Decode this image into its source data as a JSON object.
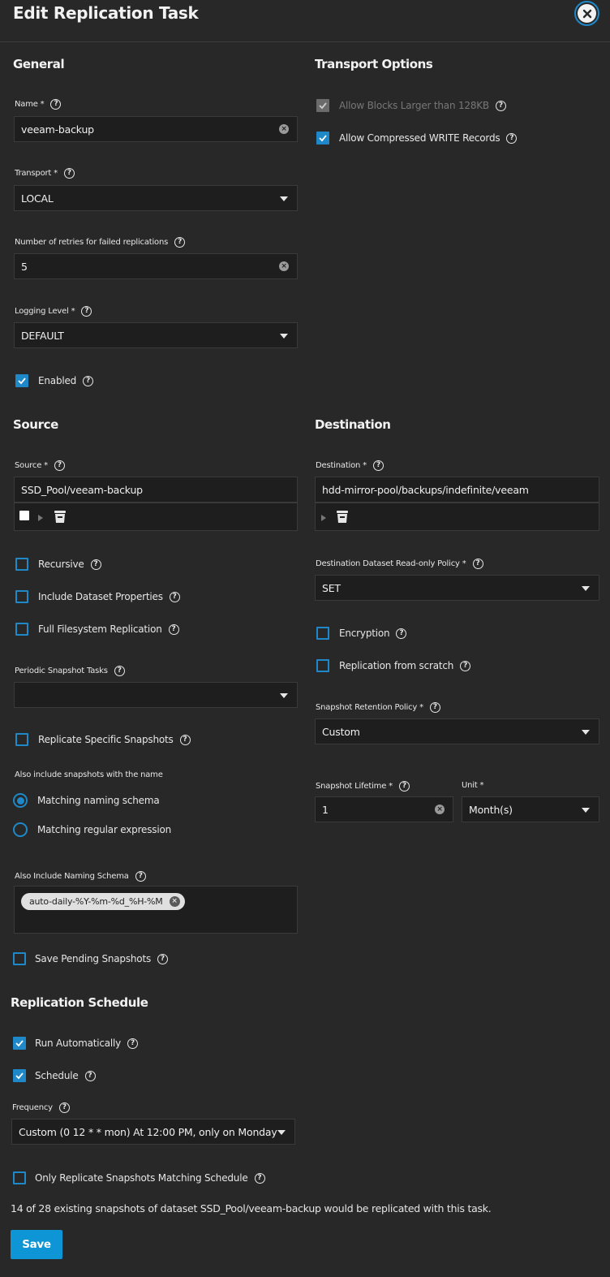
{
  "dialog": {
    "title": "Edit Replication Task",
    "close_icon": "close-icon"
  },
  "general": {
    "heading": "General",
    "name": {
      "label": "Name *",
      "value": "veeam-backup"
    },
    "transport": {
      "label": "Transport *",
      "value": "LOCAL"
    },
    "retries": {
      "label": "Number of retries for failed replications",
      "value": "5"
    },
    "logging": {
      "label": "Logging Level *",
      "value": "DEFAULT"
    },
    "enabled": {
      "label": "Enabled",
      "checked": true
    }
  },
  "transport_options": {
    "heading": "Transport Options",
    "large_blocks": {
      "label": "Allow Blocks Larger than 128KB",
      "checked": true,
      "disabled": true
    },
    "compressed": {
      "label": "Allow Compressed WRITE Records",
      "checked": true
    }
  },
  "source": {
    "heading": "Source",
    "source": {
      "label": "Source *",
      "value": "SSD_Pool/veeam-backup"
    },
    "recursive": {
      "label": "Recursive",
      "checked": false
    },
    "include_props": {
      "label": "Include Dataset Properties",
      "checked": false
    },
    "full_fs": {
      "label": "Full Filesystem Replication",
      "checked": false
    },
    "periodic": {
      "label": "Periodic Snapshot Tasks",
      "value": ""
    },
    "specific": {
      "label": "Replicate Specific Snapshots",
      "checked": false
    },
    "also_include": {
      "label": "Also include snapshots with the name"
    },
    "radio_schema": {
      "label": "Matching naming schema",
      "selected": true
    },
    "radio_regex": {
      "label": "Matching regular expression",
      "selected": false
    },
    "naming_schema": {
      "label": "Also Include Naming Schema",
      "chips": [
        "auto-daily-%Y-%m-%d_%H-%M"
      ]
    },
    "save_pending": {
      "label": "Save Pending Snapshots",
      "checked": false
    }
  },
  "destination": {
    "heading": "Destination",
    "destination": {
      "label": "Destination *",
      "value": "hdd-mirror-pool/backups/indefinite/veeam"
    },
    "readonly_policy": {
      "label": "Destination Dataset Read-only Policy *",
      "value": "SET"
    },
    "encryption": {
      "label": "Encryption",
      "checked": false
    },
    "from_scratch": {
      "label": "Replication from scratch",
      "checked": false
    },
    "retention": {
      "label": "Snapshot Retention Policy *",
      "value": "Custom"
    },
    "lifetime": {
      "label": "Snapshot Lifetime *",
      "value": "1"
    },
    "unit": {
      "label": "Unit *",
      "value": "Month(s)"
    }
  },
  "schedule": {
    "heading": "Replication Schedule",
    "run_auto": {
      "label": "Run Automatically",
      "checked": true
    },
    "schedule": {
      "label": "Schedule",
      "checked": true
    },
    "frequency": {
      "label": "Frequency",
      "value": "Custom (0 12 * * mon) At 12:00 PM, only on Monday"
    },
    "only_matching": {
      "label": "Only Replicate Snapshots Matching Schedule",
      "checked": false
    }
  },
  "footer": {
    "info": "14 of 28 existing snapshots of dataset SSD_Pool/veeam-backup would be replicated with this task.",
    "save": "Save"
  },
  "colors": {
    "accent": "#1e88c8",
    "save_button": "#0d95d5",
    "background": "#282828",
    "input_bg": "#1e1e1e"
  }
}
